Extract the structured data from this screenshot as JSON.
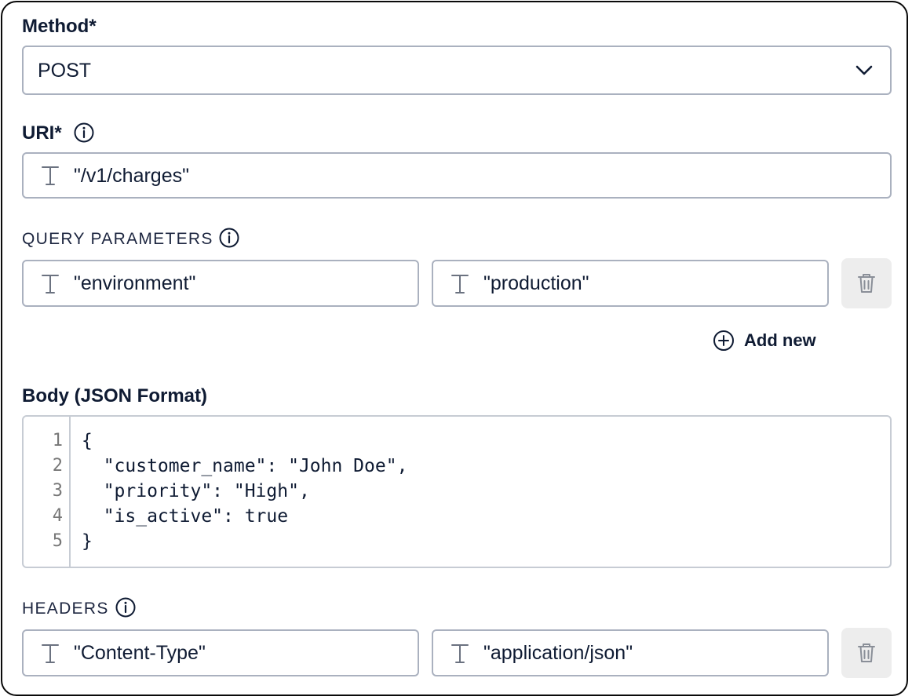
{
  "method": {
    "label": "Method*",
    "value": "POST"
  },
  "uri": {
    "label": "URI*",
    "value": "\"/v1/charges\""
  },
  "query_parameters": {
    "label": "QUERY PARAMETERS",
    "rows": [
      {
        "key": "\"environment\"",
        "value": "\"production\""
      }
    ],
    "add_label": "Add new"
  },
  "body": {
    "label": "Body (JSON Format)",
    "line_numbers": [
      "1",
      "2",
      "3",
      "4",
      "5"
    ],
    "lines": [
      "{",
      "  \"customer_name\": \"John Doe\",",
      "  \"priority\": \"High\",",
      "  \"is_active\": true",
      "}"
    ]
  },
  "headers": {
    "label": "HEADERS",
    "rows": [
      {
        "key": "\"Content-Type\"",
        "value": "\"application/json\""
      }
    ]
  },
  "icons": {
    "info": "info-icon",
    "text_type": "text-type-icon",
    "chevron": "chevron-down-icon",
    "trash": "trash-icon",
    "add": "plus-circle-icon"
  },
  "colors": {
    "text": "#0f1b33",
    "border": "#aab1bf",
    "trash_bg": "#ededed"
  }
}
